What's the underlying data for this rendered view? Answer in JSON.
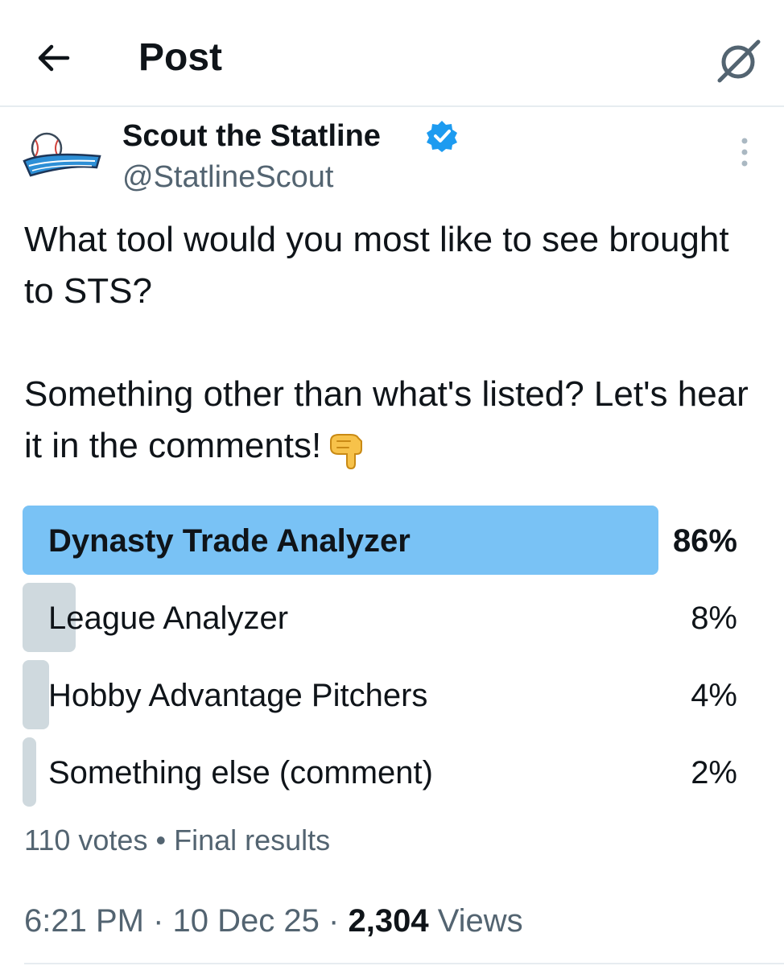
{
  "header": {
    "title": "Post"
  },
  "author": {
    "name": "Scout the Statline",
    "handle": "@StatlineScout",
    "verified": true,
    "avatar_text": "Scout the Statline"
  },
  "tweet": {
    "paragraph1": "What tool would you most like to see brought to STS?",
    "paragraph2": "Something other than what's listed? Let's hear it in the comments!",
    "emoji": "point-down-emoji"
  },
  "poll": {
    "options": [
      {
        "label": "Dynasty Trade Analyzer",
        "percent_label": "86%",
        "percent": 86,
        "winner": true
      },
      {
        "label": "League Analyzer",
        "percent_label": "8%",
        "percent": 8,
        "winner": false
      },
      {
        "label": "Hobby Advantage Pitchers",
        "percent_label": "4%",
        "percent": 4,
        "winner": false
      },
      {
        "label": "Something else (comment)",
        "percent_label": "2%",
        "percent": 2,
        "winner": false
      }
    ],
    "votes": "110 votes",
    "separator": "•",
    "status": "Final results"
  },
  "meta": {
    "time": "6:21 PM",
    "date": "10 Dec 25",
    "dot": "·",
    "views_count": "2,304",
    "views_label": "Views"
  },
  "colors": {
    "winner_bar": "#79c2f5",
    "other_bar": "#cfd9de",
    "verified": "#1d9bf0",
    "secondary_text": "#536471"
  }
}
